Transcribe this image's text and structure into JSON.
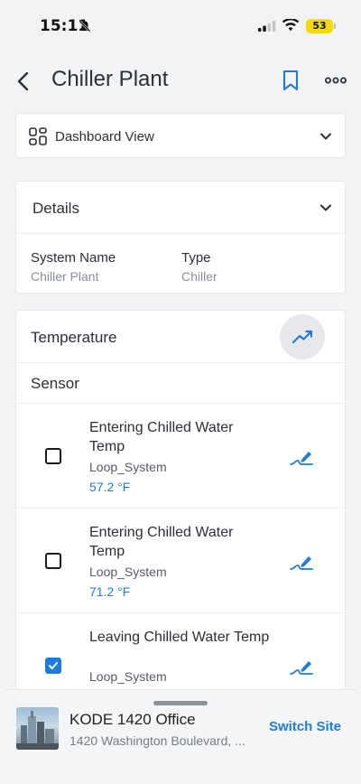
{
  "status_bar": {
    "time": "15:11",
    "battery": "53",
    "icons": [
      "bell-slash-icon",
      "cellular-signal-icon",
      "wifi-icon",
      "battery-icon"
    ]
  },
  "nav": {
    "title": "Chiller Plant",
    "icons": [
      "back-chevron-icon",
      "bookmark-icon",
      "more-dots-icon"
    ]
  },
  "view_selector": {
    "label": "Dashboard View",
    "icon": "grid-icon"
  },
  "details": {
    "title": "Details",
    "fields": [
      {
        "label": "System Name",
        "value": "Chiller Plant"
      },
      {
        "label": "Type",
        "value": "Chiller"
      }
    ]
  },
  "temperature": {
    "title": "Temperature",
    "sensor_header": "Sensor",
    "trend_icon": "trend-line-icon",
    "sensors": [
      {
        "name": "Entering Chilled Water Temp",
        "loop": "Loop_System",
        "value": "57.2 °F",
        "checked": false
      },
      {
        "name": "Entering Chilled Water Temp",
        "loop": "Loop_System",
        "value": "71.2 °F",
        "checked": false
      },
      {
        "name": "Leaving Chilled Water Temp",
        "loop": "Loop_System",
        "value": "",
        "checked": true
      }
    ]
  },
  "site": {
    "name": "KODE 1420 Office",
    "address": "1420 Washington Boulevard, ...",
    "switch_label": "Switch Site"
  },
  "colors": {
    "accent": "#1e7be0",
    "background": "#f2f3f5",
    "battery": "#f5d90a"
  }
}
